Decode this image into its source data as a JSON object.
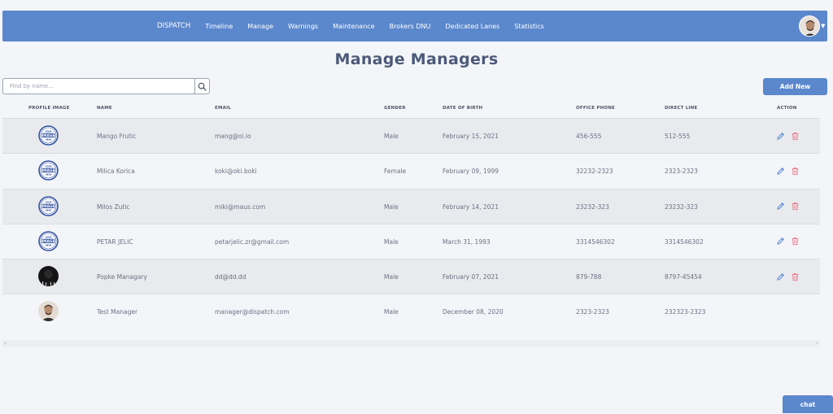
{
  "nav": {
    "brand": "DISPATCH",
    "links": [
      "Timeline",
      "Manage",
      "Warnings",
      "Maintenance",
      "Brokers DNU",
      "Dedicated Lanes",
      "Statistics"
    ]
  },
  "title": "Manage Managers",
  "search": {
    "placeholder": "Find by name...",
    "value": ""
  },
  "add_new": "Add New",
  "columns": [
    "PROFILE IMAGE",
    "NAME",
    "EMAIL",
    "GENDER",
    "DATE OF BIRTH",
    "OFFICE PHONE",
    "DIRECT LINE",
    "ACTION"
  ],
  "placeholder_image": {
    "line1": "YOUR",
    "line2": "IMAGE",
    "line3": "HERE"
  },
  "rows": [
    {
      "image": "placeholder",
      "name": "Mango Frutic",
      "email": "mang@oi.io",
      "gender": "Male",
      "dob": "February 15, 2021",
      "office": "456-555",
      "direct": "512-555",
      "actions": true
    },
    {
      "image": "placeholder",
      "name": "Milica Korica",
      "email": "koki@oki.boki",
      "gender": "Female",
      "dob": "February 09, 1999",
      "office": "32232-2323",
      "direct": "2323-2323",
      "actions": true
    },
    {
      "image": "placeholder",
      "name": "Milos Zutic",
      "email": "miki@maus.com",
      "gender": "Male",
      "dob": "February 14, 2021",
      "office": "23232-323",
      "direct": "23232-323",
      "actions": true
    },
    {
      "image": "placeholder",
      "name": "PETAR JELIC",
      "email": "petarjelic.zr@gmail.com",
      "gender": "Male",
      "dob": "March 31, 1993",
      "office": "3314546302",
      "direct": "3314546302",
      "actions": true
    },
    {
      "image": "dark-photo",
      "name": "Popke Managary",
      "email": "dd@dd.dd",
      "gender": "Male",
      "dob": "February 07, 2021",
      "office": "879-788",
      "direct": "8797-45454",
      "actions": true
    },
    {
      "image": "person-photo",
      "name": "Test Manager",
      "email": "manager@dispatch.com",
      "gender": "Male",
      "dob": "December 08, 2020",
      "office": "2323-2323",
      "direct": "232323-2323",
      "actions": false
    }
  ],
  "chat": "chat",
  "colors": {
    "accent": "#5b87cc",
    "edit": "#5b87cc",
    "delete": "#e8798a",
    "title": "#4c5a78"
  },
  "icons": {
    "search": "search-icon",
    "edit": "pencil-icon",
    "delete": "trash-icon"
  }
}
